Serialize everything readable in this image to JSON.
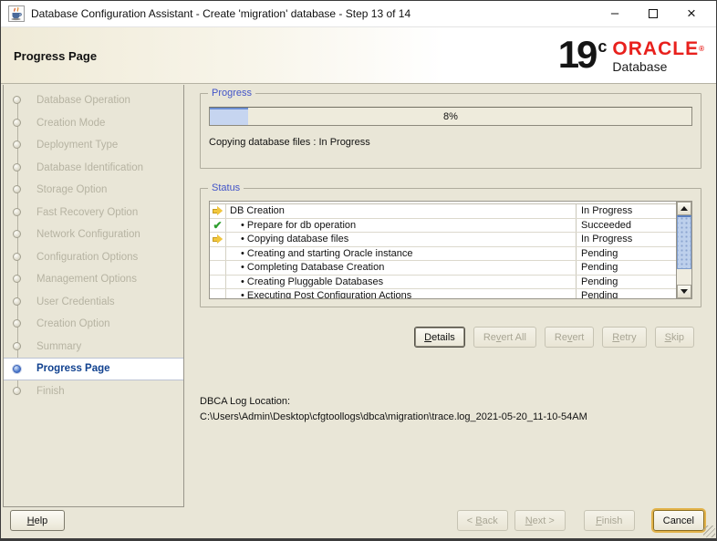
{
  "window": {
    "title": "Database Configuration Assistant - Create 'migration' database - Step 13 of 14",
    "minimize_glyph": "–",
    "close_glyph": "×"
  },
  "header": {
    "title": "Progress Page",
    "logo": {
      "version": "19",
      "edition": "c",
      "brand": "ORACLE",
      "registered": "®",
      "product": "Database"
    }
  },
  "sidebar": {
    "steps": [
      {
        "label": "Database Operation",
        "state": "inactive"
      },
      {
        "label": "Creation Mode",
        "state": "inactive"
      },
      {
        "label": "Deployment Type",
        "state": "inactive"
      },
      {
        "label": "Database Identification",
        "state": "inactive"
      },
      {
        "label": "Storage Option",
        "state": "inactive"
      },
      {
        "label": "Fast Recovery Option",
        "state": "inactive"
      },
      {
        "label": "Network Configuration",
        "state": "inactive"
      },
      {
        "label": "Configuration Options",
        "state": "inactive"
      },
      {
        "label": "Management Options",
        "state": "inactive"
      },
      {
        "label": "User Credentials",
        "state": "inactive"
      },
      {
        "label": "Creation Option",
        "state": "inactive"
      },
      {
        "label": "Summary",
        "state": "inactive"
      },
      {
        "label": "Progress Page",
        "state": "active"
      },
      {
        "label": "Finish",
        "state": "inactive"
      }
    ]
  },
  "progress": {
    "group_title": "Progress",
    "percent_label": "8%",
    "percent_value": 8,
    "status_line": "Copying database files : In Progress"
  },
  "status": {
    "group_title": "Status",
    "rows": [
      {
        "icon": "arrow",
        "indent": "false",
        "label": "DB Creation",
        "status": "In Progress"
      },
      {
        "icon": "check",
        "indent": "true",
        "label": "• Prepare for db operation",
        "status": "Succeeded"
      },
      {
        "icon": "arrow",
        "indent": "true",
        "label": "• Copying database files",
        "status": "In Progress"
      },
      {
        "icon": "none",
        "indent": "true",
        "label": "• Creating and starting Oracle instance",
        "status": "Pending"
      },
      {
        "icon": "none",
        "indent": "true",
        "label": "• Completing Database Creation",
        "status": "Pending"
      },
      {
        "icon": "none",
        "indent": "true",
        "label": "• Creating Pluggable Databases",
        "status": "Pending"
      },
      {
        "icon": "none",
        "indent": "true",
        "label": "• Executing Post Configuration Actions",
        "status": "Pending"
      }
    ]
  },
  "actions": {
    "details": {
      "label": "Details",
      "mnemonic": 0,
      "enabled": "true"
    },
    "revert_all": {
      "label": "Revert All",
      "mnemonic": 2,
      "enabled": "false"
    },
    "revert": {
      "label": "Revert",
      "mnemonic": 2,
      "enabled": "false"
    },
    "retry": {
      "label": "Retry",
      "mnemonic": 0,
      "enabled": "false"
    },
    "skip": {
      "label": "Skip",
      "mnemonic": 0,
      "enabled": "false"
    }
  },
  "log": {
    "label": "DBCA Log Location:",
    "path": "C:\\Users\\Admin\\Desktop\\cfgtoollogs\\dbca\\migration\\trace.log_2021-05-20_11-10-54AM"
  },
  "footer": {
    "help": {
      "label": "Help",
      "mnemonic": 0,
      "enabled": "true"
    },
    "back": {
      "label": "< Back",
      "mnemonic": 2,
      "enabled": "false"
    },
    "next": {
      "label": "Next >",
      "mnemonic": 0,
      "enabled": "false"
    },
    "finish": {
      "label": "Finish",
      "mnemonic": 0,
      "enabled": "false"
    },
    "cancel": {
      "label": "Cancel",
      "mnemonic": -1,
      "enabled": "true"
    }
  },
  "colors": {
    "oracle_red": "#e8211d",
    "group_title_blue": "#4254c8",
    "active_step_blue": "#10418f",
    "progress_fill_blue": "#c6d5f0",
    "success_green": "#2f9e2f",
    "arrow_gold": "#f2c73d",
    "background_beige": "#e9e6d7"
  }
}
